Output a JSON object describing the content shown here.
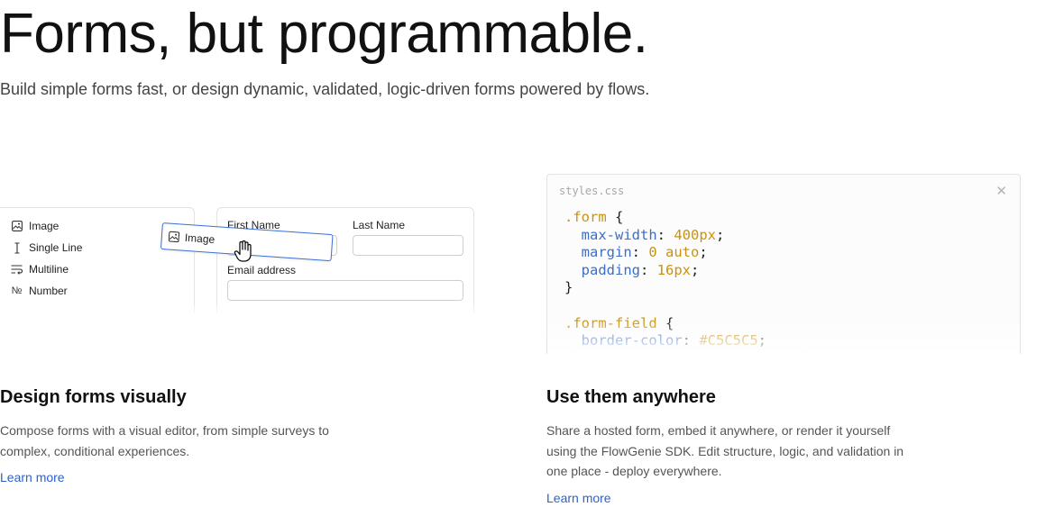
{
  "hero": {
    "title": "Forms, but programmable.",
    "subtitle": "Build simple forms fast, or design dynamic, validated, logic-driven forms powered by flows."
  },
  "palette": {
    "items": [
      {
        "icon": "image-icon",
        "label": "Image"
      },
      {
        "icon": "text-cursor-icon",
        "label": "Single Line"
      },
      {
        "icon": "multiline-icon",
        "label": "Multiline"
      },
      {
        "icon": "number-icon",
        "label": "Number",
        "glyph": "№"
      }
    ]
  },
  "drag_chip": {
    "icon": "image-icon",
    "label": "Image"
  },
  "form_preview": {
    "first_name_label": "First Name",
    "last_name_label": "Last Name",
    "email_label": "Email address"
  },
  "code_panel": {
    "filename": "styles.css",
    "lines": [
      [
        {
          "t": ".form",
          "k": "sel"
        },
        {
          "t": " {",
          "k": "brace"
        }
      ],
      [
        {
          "t": "  max-width",
          "k": "prop"
        },
        {
          "t": ": ",
          "k": "punc"
        },
        {
          "t": "400px",
          "k": "val"
        },
        {
          "t": ";",
          "k": "punc"
        }
      ],
      [
        {
          "t": "  margin",
          "k": "prop"
        },
        {
          "t": ": ",
          "k": "punc"
        },
        {
          "t": "0 auto",
          "k": "val"
        },
        {
          "t": ";",
          "k": "punc"
        }
      ],
      [
        {
          "t": "  padding",
          "k": "prop"
        },
        {
          "t": ": ",
          "k": "punc"
        },
        {
          "t": "16px",
          "k": "val"
        },
        {
          "t": ";",
          "k": "punc"
        }
      ],
      [
        {
          "t": "}",
          "k": "brace"
        }
      ],
      [
        {
          "t": "",
          "k": "punc"
        }
      ],
      [
        {
          "t": ".form-field",
          "k": "sel"
        },
        {
          "t": " {",
          "k": "brace"
        }
      ],
      [
        {
          "t": "  border-color",
          "k": "prop"
        },
        {
          "t": ": ",
          "k": "punc"
        },
        {
          "t": "#C5C5C5",
          "k": "val"
        },
        {
          "t": ";",
          "k": "punc"
        }
      ]
    ]
  },
  "features": [
    {
      "title": "Design forms visually",
      "description": "Compose forms with a visual editor, from simple surveys to complex, conditional experiences.",
      "link": "Learn more"
    },
    {
      "title": "Use them anywhere",
      "description": "Share a hosted form, embed it anywhere, or render it yourself using the FlowGenie SDK. Edit structure, logic, and validation in one place - deploy everywhere.",
      "link": "Learn more"
    }
  ],
  "colors": {
    "link": "#2a63d0",
    "drag_border": "#3b6fd8",
    "code_selector": "#c9920f",
    "code_property": "#3b6ec9"
  }
}
